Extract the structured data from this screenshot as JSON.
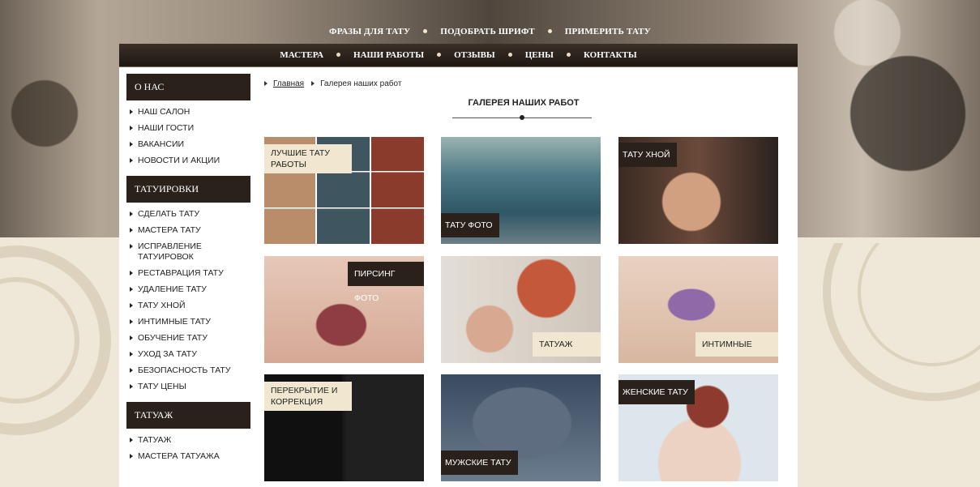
{
  "top_menu": [
    "Фразы для тату",
    "Подобрать шрифт",
    "Примерить тату"
  ],
  "main_menu": [
    "Мастера",
    "Наши работы",
    "Отзывы",
    "Цены",
    "Контакты"
  ],
  "sidebar": {
    "sections": [
      {
        "title": "О нас",
        "items": [
          "Наш салон",
          "Наши гости",
          "Вакансии",
          "Новости и акции"
        ]
      },
      {
        "title": "Татуировки",
        "items": [
          "Сделать тату",
          "Мастера тату",
          "Исправление татуировок",
          "Реставрация тату",
          "Удаление тату",
          "Тату хной",
          "Интимные тату",
          "Обучение тату",
          "Уход за тату",
          "Безопасность тату",
          "Тату цены"
        ]
      },
      {
        "title": "Татуаж",
        "items": [
          "Татуаж",
          "Мастера татуажа"
        ]
      }
    ]
  },
  "breadcrumb": {
    "home": "Главная",
    "current": "Галерея наших работ"
  },
  "page_title": "Галерея наших работ",
  "gallery": [
    {
      "label": "Лучшие тату работы"
    },
    {
      "label": "Тату фото"
    },
    {
      "label": "Тату хной"
    },
    {
      "label": "Пирсинг фото"
    },
    {
      "label": "Татуаж фото"
    },
    {
      "label": "Интимные тату"
    },
    {
      "label": "Перекрытие и коррекция"
    },
    {
      "label": "Мужские тату"
    },
    {
      "label": "Женские тату"
    }
  ],
  "colors": {
    "dark": "#2a211b",
    "cream": "#f1e7d0",
    "page_bg": "#efe8d8"
  }
}
